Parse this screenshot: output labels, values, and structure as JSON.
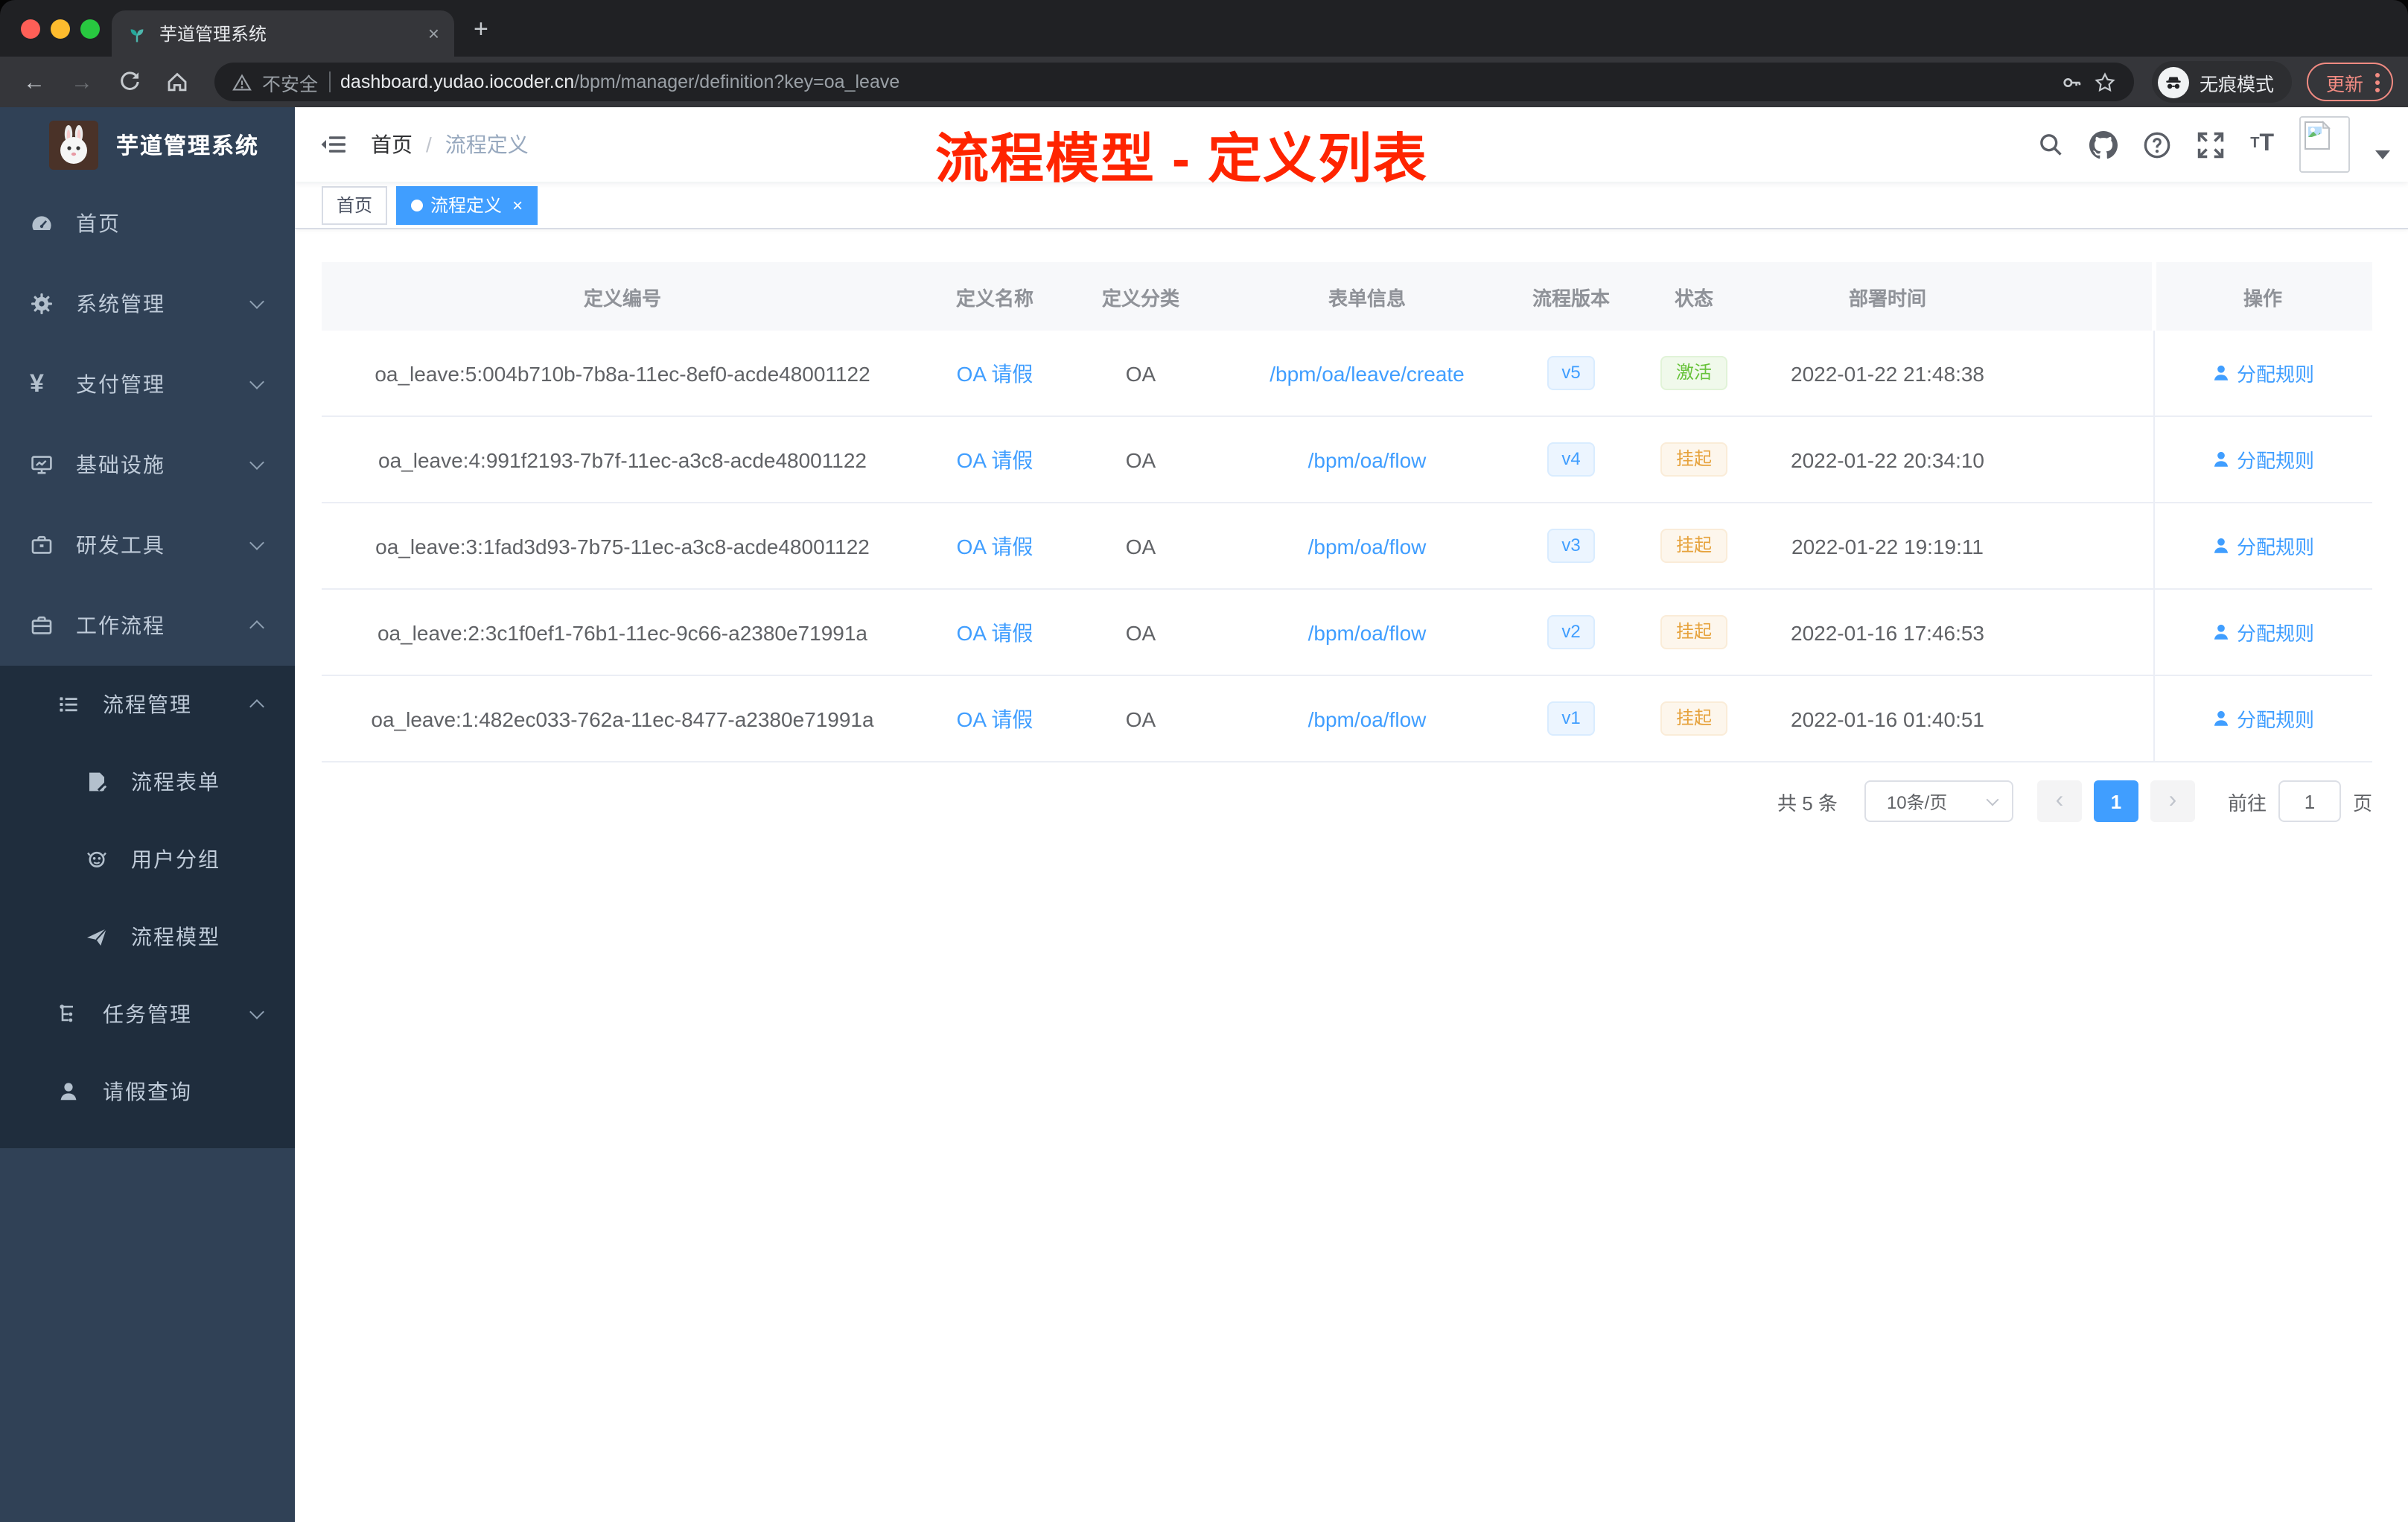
{
  "browser": {
    "tab": {
      "title": "芋道管理系统",
      "close": "×"
    },
    "new_tab_button": "+",
    "nav": {
      "back": "←",
      "forward": "→"
    },
    "omnibox": {
      "security_label": "不安全",
      "host": "dashboard.yudao.iocoder.cn",
      "path": "/bpm/manager/definition?key=oa_leave"
    },
    "incognito_label": "无痕模式",
    "update_button": "更新"
  },
  "sidebar": {
    "logo_title": "芋道管理系统",
    "menu": [
      {
        "label": "首页",
        "icon": "dashboard-icon"
      },
      {
        "label": "系统管理",
        "icon": "gear-icon",
        "expand": "down"
      },
      {
        "label": "支付管理",
        "icon": "yen-icon",
        "expand": "down"
      },
      {
        "label": "基础设施",
        "icon": "monitor-icon",
        "expand": "down"
      },
      {
        "label": "研发工具",
        "icon": "toolbox-icon",
        "expand": "down"
      },
      {
        "label": "工作流程",
        "icon": "workflow-icon",
        "expand": "up"
      }
    ],
    "submenu": [
      {
        "label": "流程管理",
        "icon": "list-icon",
        "expand": "up"
      },
      {
        "label": "流程表单",
        "icon": "form-icon"
      },
      {
        "label": "用户分组",
        "icon": "group-icon"
      },
      {
        "label": "流程模型",
        "icon": "paper-plane-icon"
      },
      {
        "label": "任务管理",
        "icon": "task-tree-icon",
        "expand": "down"
      },
      {
        "label": "请假查询",
        "icon": "person-icon"
      }
    ]
  },
  "header": {
    "breadcrumb": {
      "home": "首页",
      "separator": "/",
      "current": "流程定义"
    },
    "annotation": "流程模型 - 定义列表"
  },
  "tags": [
    {
      "label": "首页",
      "active": false
    },
    {
      "label": "流程定义",
      "active": true,
      "close": "×"
    }
  ],
  "table": {
    "columns": [
      "定义编号",
      "定义名称",
      "定义分类",
      "表单信息",
      "流程版本",
      "状态",
      "部署时间",
      "操作"
    ],
    "rows": [
      {
        "id": "oa_leave:5:004b710b-7b8a-11ec-8ef0-acde48001122",
        "name": "OA 请假",
        "category": "OA",
        "form": "/bpm/oa/leave/create",
        "version": "v5",
        "status": "激活",
        "status_type": "success",
        "time": "2022-01-22 21:48:38",
        "action": "分配规则"
      },
      {
        "id": "oa_leave:4:991f2193-7b7f-11ec-a3c8-acde48001122",
        "name": "OA 请假",
        "category": "OA",
        "form": "/bpm/oa/flow",
        "version": "v4",
        "status": "挂起",
        "status_type": "warning",
        "time": "2022-01-22 20:34:10",
        "action": "分配规则"
      },
      {
        "id": "oa_leave:3:1fad3d93-7b75-11ec-a3c8-acde48001122",
        "name": "OA 请假",
        "category": "OA",
        "form": "/bpm/oa/flow",
        "version": "v3",
        "status": "挂起",
        "status_type": "warning",
        "time": "2022-01-22 19:19:11",
        "action": "分配规则"
      },
      {
        "id": "oa_leave:2:3c1f0ef1-76b1-11ec-9c66-a2380e71991a",
        "name": "OA 请假",
        "category": "OA",
        "form": "/bpm/oa/flow",
        "version": "v2",
        "status": "挂起",
        "status_type": "warning",
        "time": "2022-01-16 17:46:53",
        "action": "分配规则"
      },
      {
        "id": "oa_leave:1:482ec033-762a-11ec-8477-a2380e71991a",
        "name": "OA 请假",
        "category": "OA",
        "form": "/bpm/oa/flow",
        "version": "v1",
        "status": "挂起",
        "status_type": "warning",
        "time": "2022-01-16 01:40:51",
        "action": "分配规则"
      }
    ]
  },
  "pagination": {
    "total": "共 5 条",
    "page_size": "10条/页",
    "prev": "‹",
    "next": "›",
    "current_page": "1",
    "goto_label": "前往",
    "goto_value": "1",
    "page_unit": "页"
  },
  "colors": {
    "primary": "#409eff",
    "success": "#67c23a",
    "warning": "#e6a23c",
    "sidebar_bg": "#304156",
    "submenu_bg": "#1f2d3d",
    "sidebar_text": "#bfcbd9",
    "tag_active": "#409eff",
    "annotation": "#ff2400",
    "header_text": "#909399"
  }
}
